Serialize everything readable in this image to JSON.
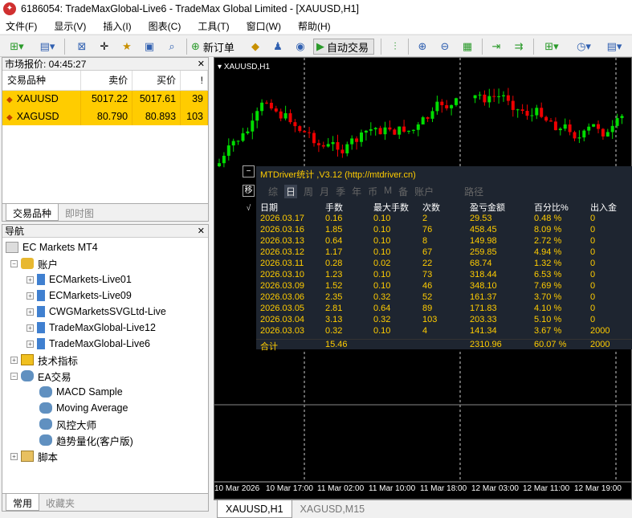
{
  "window": {
    "title": "6186054: TradeMaxGlobal-Live6 - TradeMax Global Limited - [XAUUSD,H1]"
  },
  "menu": [
    "文件(F)",
    "显示(V)",
    "插入(I)",
    "图表(C)",
    "工具(T)",
    "窗口(W)",
    "帮助(H)"
  ],
  "toolbar": {
    "new_order": "新订单",
    "auto_trading": "自动交易"
  },
  "market_watch": {
    "title": "市场报价: 04:45:27",
    "headers": [
      "交易品种",
      "卖价",
      "买价",
      "!"
    ],
    "rows": [
      {
        "symbol": "XAUUSD",
        "bid": "5017.22",
        "ask": "5017.61",
        "spread": "39"
      },
      {
        "symbol": "XAGUSD",
        "bid": "80.790",
        "ask": "80.893",
        "spread": "103"
      }
    ],
    "tabs": [
      "交易品种",
      "即时图"
    ]
  },
  "navigator": {
    "title": "导航",
    "root": "EC Markets MT4",
    "accounts_label": "账户",
    "accounts": [
      "ECMarkets-Live01",
      "ECMarkets-Live09",
      "CWGMarketsSVGLtd-Live",
      "TradeMaxGlobal-Live12",
      "TradeMaxGlobal-Live6"
    ],
    "indicators_label": "技术指标",
    "ea_label": "EA交易",
    "eas": [
      "MACD Sample",
      "Moving Average",
      "风控大师",
      "趋势量化(客户版)"
    ],
    "scripts_label": "脚本",
    "tabs": [
      "常用",
      "收藏夹"
    ]
  },
  "chart": {
    "symbol_label": "XAUUSD,H1",
    "x_labels": [
      "10 Mar 2026",
      "10 Mar 17:00",
      "11 Mar 02:00",
      "11 Mar 10:00",
      "11 Mar 18:00",
      "12 Mar 03:00",
      "12 Mar 11:00",
      "12 Mar 19:00"
    ],
    "tabs": [
      "XAUUSD,H1",
      "XAGUSD,M15"
    ],
    "up_color": "#00dd00",
    "down_color": "#ee0000"
  },
  "stats": {
    "title": "MTDriver统计 ,V3.12 (http://mtdriver.cn)",
    "icon_label": "移",
    "check_label": "√",
    "tabs": [
      "综",
      "日",
      "周",
      "月",
      "季",
      "年",
      "币",
      "M",
      "备",
      "账户",
      "路径"
    ],
    "headers": [
      "日期",
      "手数",
      "最大手数",
      "次数",
      "盈亏金额",
      "百分比%",
      "出入金"
    ],
    "rows": [
      [
        "2026.03.17",
        "0.16",
        "0.10",
        "2",
        "29.53",
        "0.48 %",
        "0"
      ],
      [
        "2026.03.16",
        "1.85",
        "0.10",
        "76",
        "458.45",
        "8.09 %",
        "0"
      ],
      [
        "2026.03.13",
        "0.64",
        "0.10",
        "8",
        "149.98",
        "2.72 %",
        "0"
      ],
      [
        "2026.03.12",
        "1.17",
        "0.10",
        "67",
        "259.85",
        "4.94 %",
        "0"
      ],
      [
        "2026.03.11",
        "0.28",
        "0.02",
        "22",
        "68.74",
        "1.32 %",
        "0"
      ],
      [
        "2026.03.10",
        "1.23",
        "0.10",
        "73",
        "318.44",
        "6.53 %",
        "0"
      ],
      [
        "2026.03.09",
        "1.52",
        "0.10",
        "46",
        "348.10",
        "7.69 %",
        "0"
      ],
      [
        "2026.03.06",
        "2.35",
        "0.32",
        "52",
        "161.37",
        "3.70 %",
        "0"
      ],
      [
        "2026.03.05",
        "2.81",
        "0.64",
        "89",
        "171.83",
        "4.10 %",
        "0"
      ],
      [
        "2026.03.04",
        "3.13",
        "0.32",
        "103",
        "203.33",
        "5.10 %",
        "0"
      ],
      [
        "2026.03.03",
        "0.32",
        "0.10",
        "4",
        "141.34",
        "3.67 %",
        "2000"
      ]
    ],
    "total": [
      "合计",
      "15.46",
      "",
      "",
      "2310.96",
      "60.07 %",
      "2000"
    ]
  }
}
